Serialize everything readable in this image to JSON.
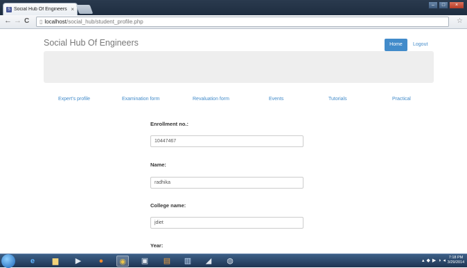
{
  "browser": {
    "tab_title": "Social Hub Of Engineers",
    "tab_favicon": "S",
    "tab_close": "×",
    "url_host": "localhost",
    "url_path": "/social_hub/student_profile.php",
    "back_glyph": "←",
    "forward_glyph": "→",
    "reload_glyph": "C",
    "star_glyph": "☆"
  },
  "header": {
    "brand": "Social Hub Of Engineers",
    "home_label": "Home",
    "logout_label": "Logout",
    "accent_color": "#428bca"
  },
  "menu": [
    {
      "label": "Expert's profile"
    },
    {
      "label": "Examination form"
    },
    {
      "label": "Revaluation form"
    },
    {
      "label": "Events"
    },
    {
      "label": "Tutorials"
    },
    {
      "label": "Practical"
    }
  ],
  "form": {
    "enrollment_label": "Enrollment no.:",
    "enrollment_value": "10447467",
    "name_label": "Name:",
    "name_value": "radhika",
    "college_label": "College name:",
    "college_value": "jdiet",
    "year_label": "Year:"
  },
  "taskbar": {
    "time": "7:18 PM",
    "date": "3/29/2014",
    "icons": [
      "start-orb",
      "internet-explorer-icon",
      "file-explorer-icon",
      "media-player-icon",
      "firefox-icon",
      "chrome-icon",
      "terminal-icon",
      "paint-icon",
      "notepad-icon",
      "document-icon",
      "paint-brush-icon"
    ]
  }
}
